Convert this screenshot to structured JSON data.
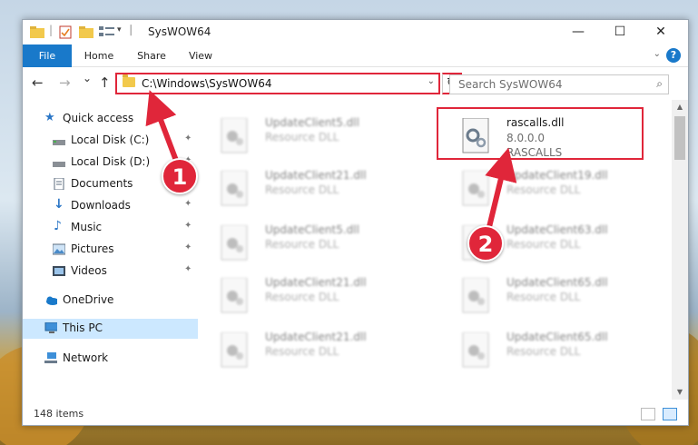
{
  "window": {
    "title": "SysWOW64",
    "controls": {
      "minimize": "—",
      "maximize": "☐",
      "close": "✕"
    }
  },
  "ribbon": {
    "tabs": [
      {
        "label": "File"
      },
      {
        "label": "Home"
      },
      {
        "label": "Share"
      },
      {
        "label": "View"
      }
    ],
    "help": "?"
  },
  "navigation": {
    "back": "←",
    "forward": "→",
    "recent": "⌄",
    "up": "↑",
    "address": "C:\\Windows\\SysWOW64",
    "refresh": "↻",
    "search_placeholder": "Search SysWOW64"
  },
  "sidebar": {
    "items": [
      {
        "label": "Quick access",
        "icon": "star-icon",
        "pinned": false
      },
      {
        "label": "Local Disk (C:)",
        "icon": "drive-icon",
        "pinned": true
      },
      {
        "label": "Local Disk (D:)",
        "icon": "drive-icon",
        "pinned": true
      },
      {
        "label": "Documents",
        "icon": "documents-icon",
        "pinned": true
      },
      {
        "label": "Downloads",
        "icon": "download-icon",
        "pinned": true
      },
      {
        "label": "Music",
        "icon": "music-icon",
        "pinned": true
      },
      {
        "label": "Pictures",
        "icon": "pictures-icon",
        "pinned": true
      },
      {
        "label": "Videos",
        "icon": "videos-icon",
        "pinned": true
      },
      {
        "label": "OneDrive",
        "icon": "cloud-icon",
        "pinned": false
      },
      {
        "label": "This PC",
        "icon": "computer-icon",
        "pinned": false
      },
      {
        "label": "Network",
        "icon": "network-icon",
        "pinned": false
      }
    ],
    "pin_glyph": "📌"
  },
  "files": {
    "left_column": [
      {
        "name": "UpdateClient5.dll",
        "type": "Resource DLL"
      },
      {
        "name": "UpdateClient21.dll",
        "type": "Resource DLL"
      },
      {
        "name": "UpdateClient5.dll",
        "type": "Resource DLL"
      },
      {
        "name": "UpdateClient21.dll",
        "type": "Resource DLL"
      },
      {
        "name": "UpdateClient21.dll",
        "type": "Resource DLL"
      }
    ],
    "right_column": [
      {
        "name": "rascalls.dll",
        "version": "8.0.0.0",
        "type": "RASCALLS"
      },
      {
        "name": "UpdateClient19.dll",
        "type": "Resource DLL"
      },
      {
        "name": "UpdateClient63.dll",
        "type": "Resource DLL"
      },
      {
        "name": "UpdateClient65.dll",
        "type": "Resource DLL"
      },
      {
        "name": "UpdateClient65.dll",
        "type": "Resource DLL"
      }
    ]
  },
  "status": {
    "item_count": "148 items"
  },
  "annotations": {
    "step1": "1",
    "step2": "2"
  },
  "colors": {
    "accent": "#1979ca",
    "highlight": "#e0263a",
    "selected": "#cce8ff"
  }
}
